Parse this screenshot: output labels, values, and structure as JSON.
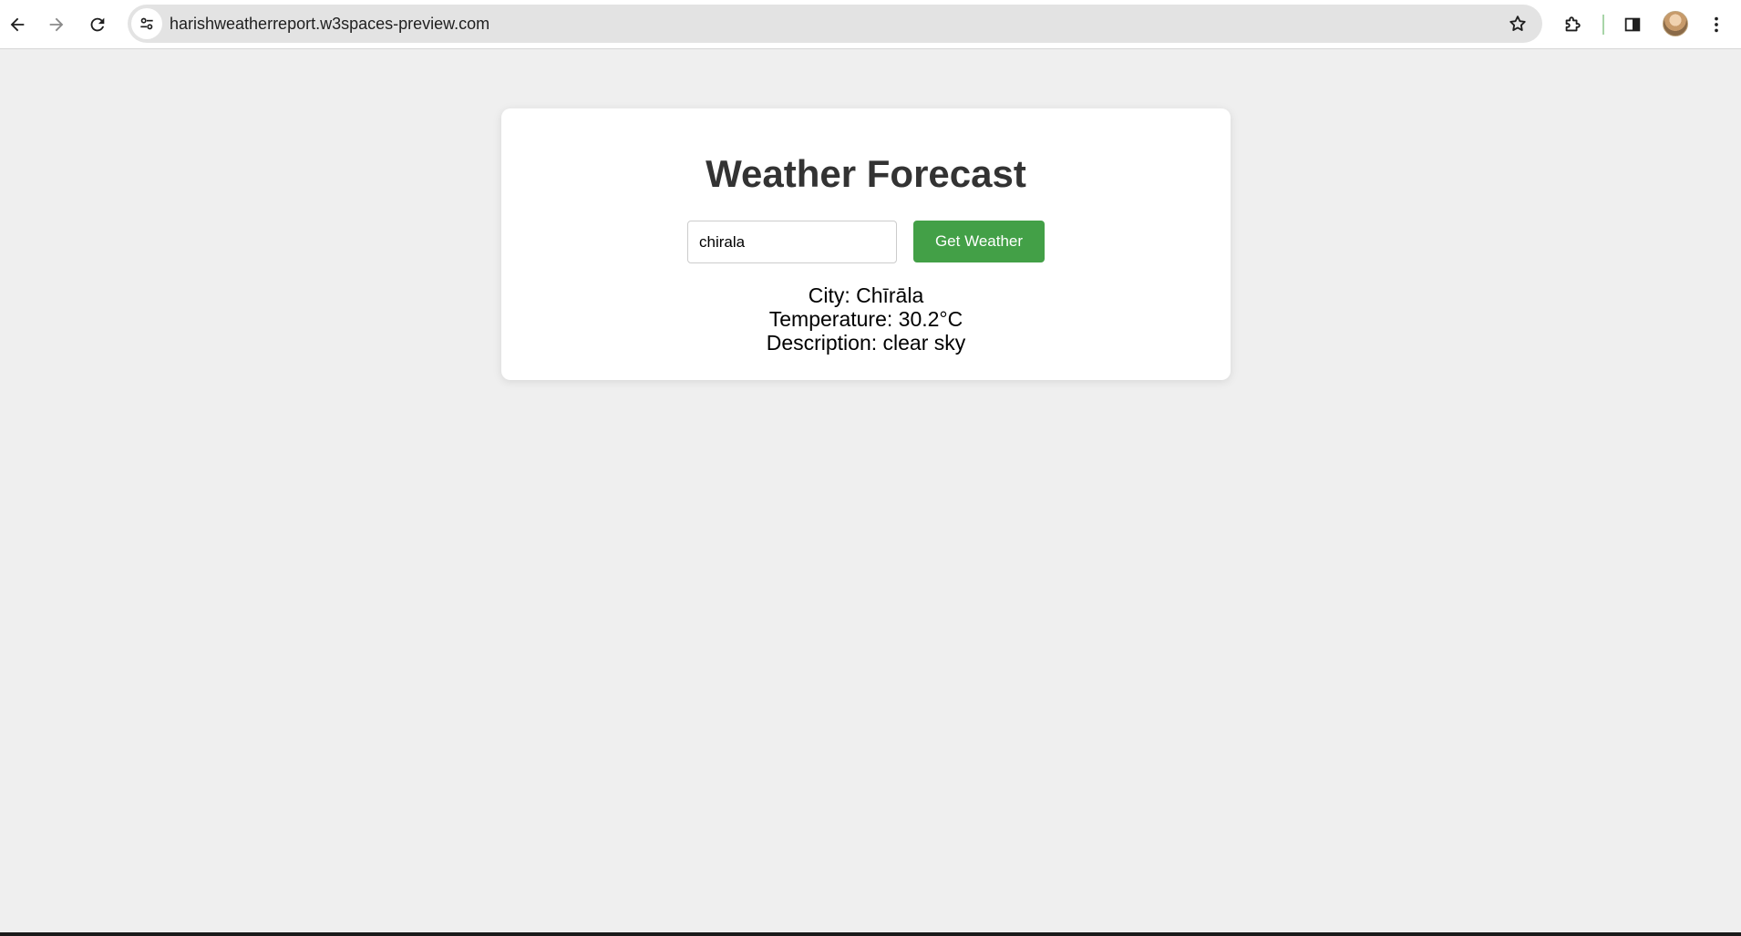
{
  "browser": {
    "url": "harishweatherreport.w3spaces-preview.com",
    "icons": {
      "back": "arrow-left-icon",
      "forward": "arrow-right-icon",
      "reload": "reload-icon",
      "site_info": "tune-icon",
      "bookmark": "star-icon",
      "extensions": "puzzle-icon",
      "side_panel": "side-panel-icon",
      "menu": "kebab-menu-icon"
    }
  },
  "app": {
    "title": "Weather Forecast",
    "city_input": {
      "value": "chirala",
      "placeholder": ""
    },
    "button_label": "Get Weather",
    "button_color": "#43a047",
    "result": {
      "city": "City: Chīrāla",
      "temperature": "Temperature: 30.2°C",
      "description": "Description: clear sky"
    }
  }
}
